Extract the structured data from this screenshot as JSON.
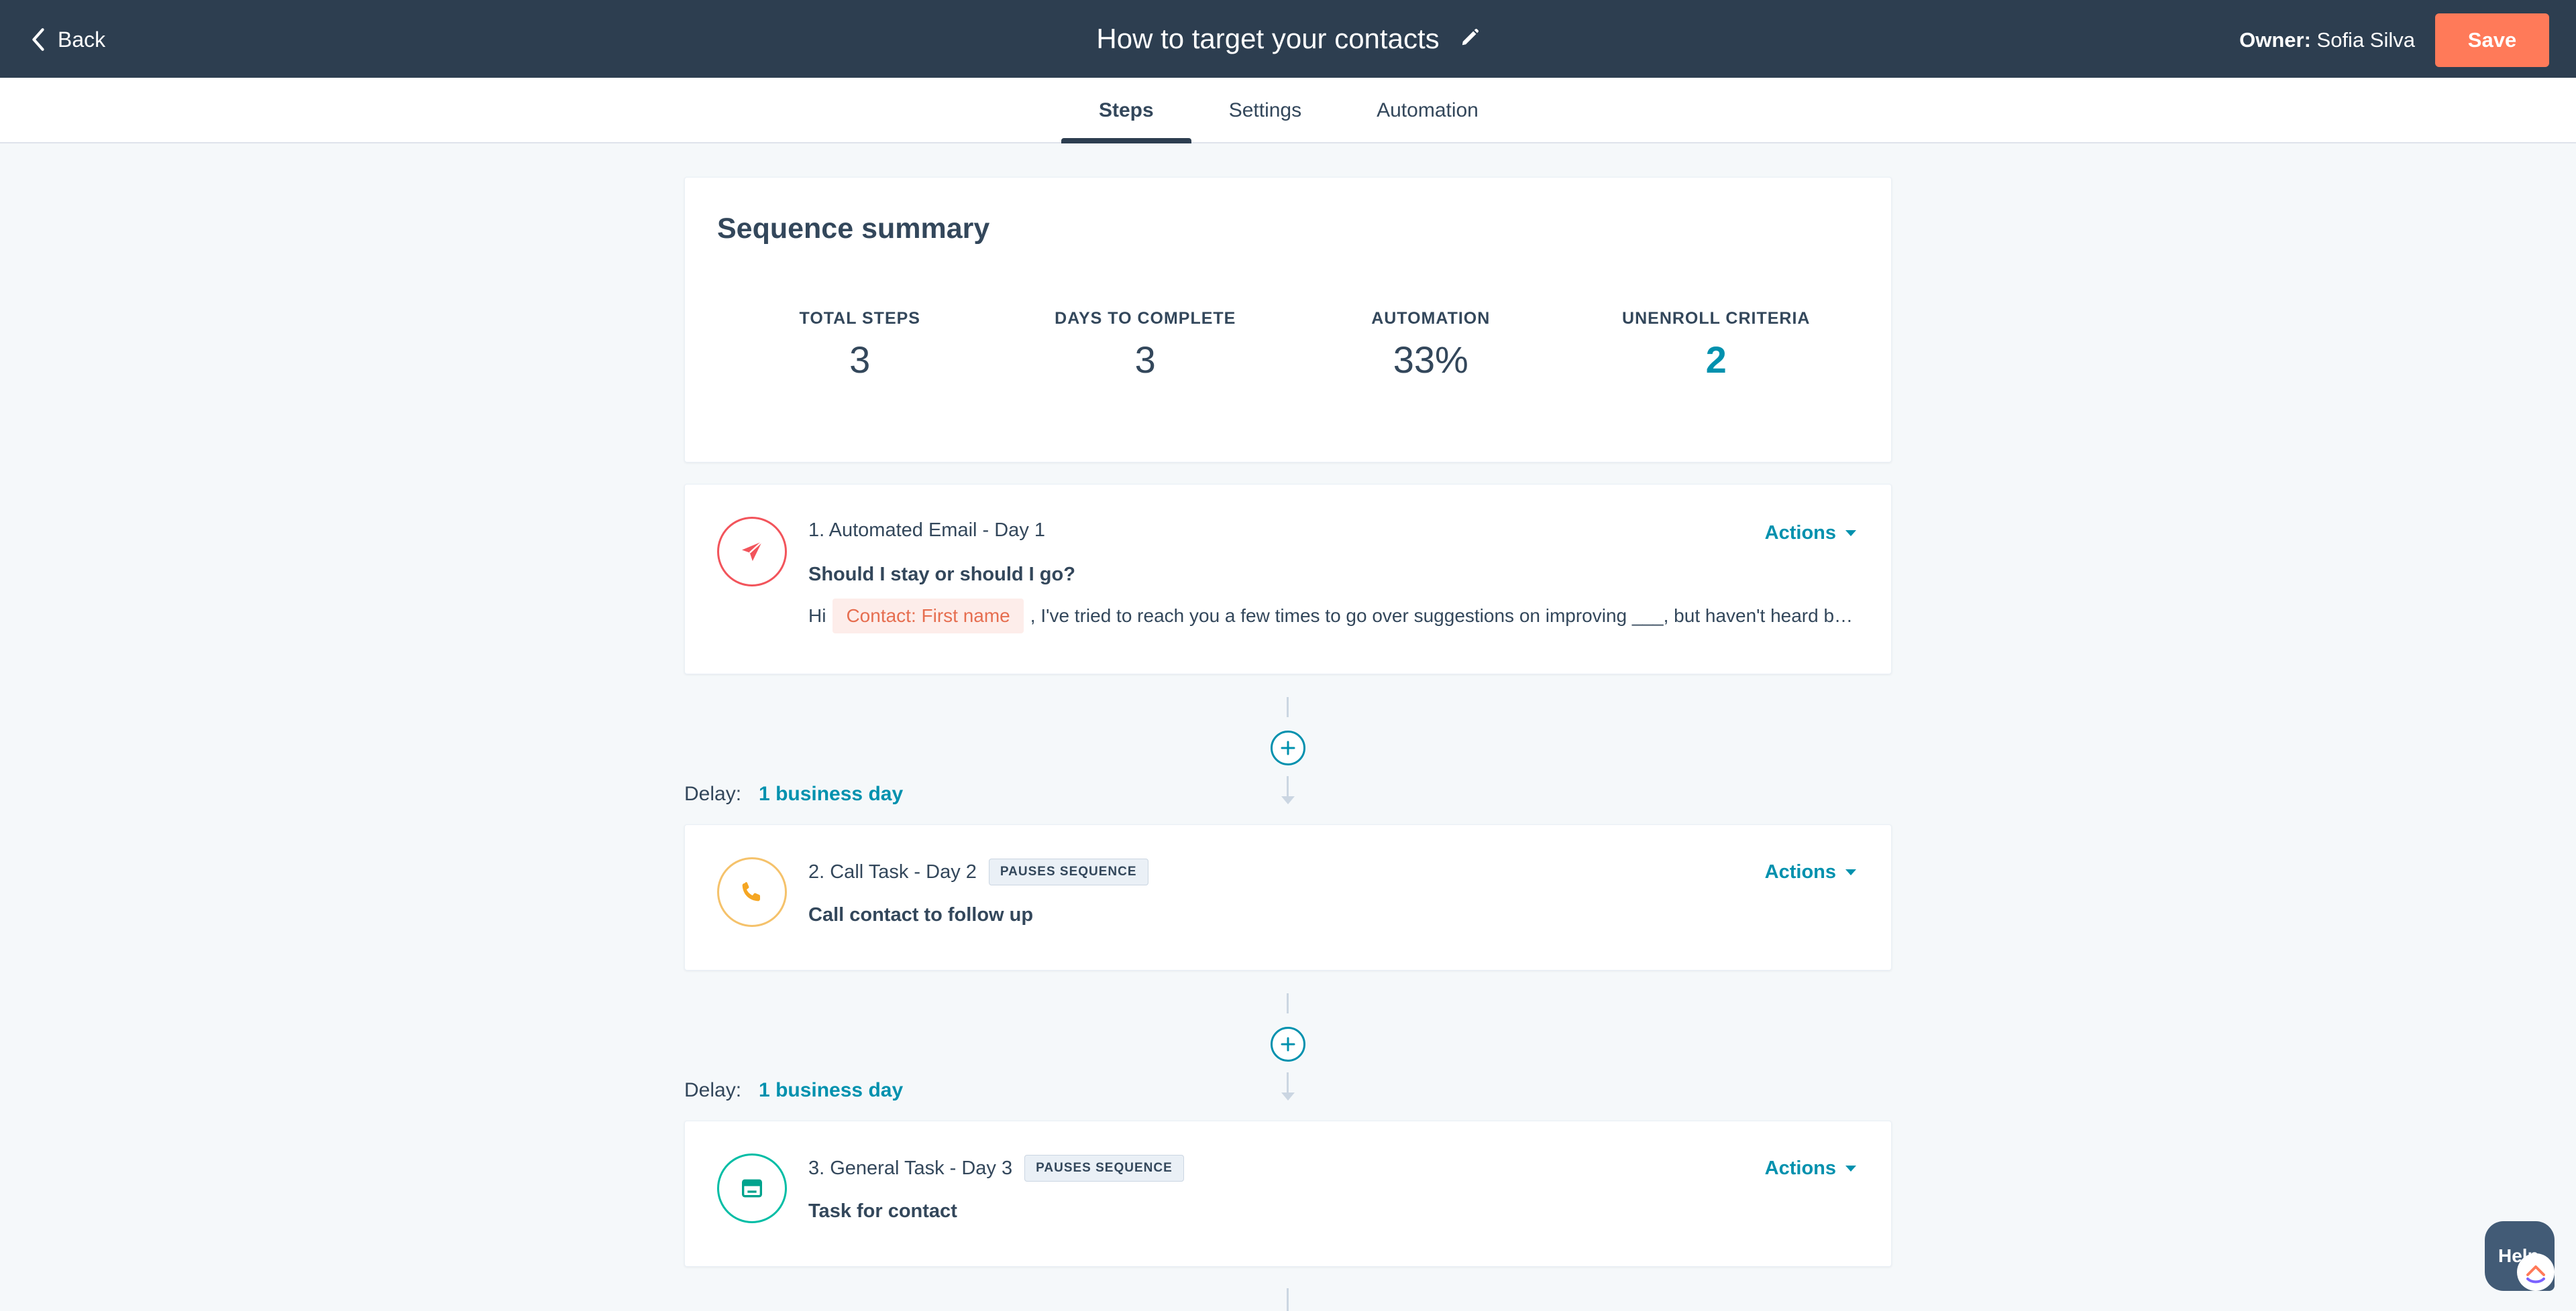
{
  "header": {
    "back_label": "Back",
    "title": "How to target your contacts",
    "owner_label": "Owner:",
    "owner_name": "Sofia Silva",
    "save_label": "Save"
  },
  "tabs": [
    {
      "label": "Steps",
      "active": true
    },
    {
      "label": "Settings",
      "active": false
    },
    {
      "label": "Automation",
      "active": false
    }
  ],
  "summary": {
    "title": "Sequence summary",
    "stats": [
      {
        "label": "TOTAL STEPS",
        "value": "3"
      },
      {
        "label": "DAYS TO COMPLETE",
        "value": "3"
      },
      {
        "label": "AUTOMATION",
        "value": "33%"
      },
      {
        "label": "UNENROLL CRITERIA",
        "value": "2"
      }
    ]
  },
  "steps": [
    {
      "heading": "1. Automated Email - Day 1",
      "subject": "Should I stay or should I go?",
      "preview_start": "Hi",
      "token": "Contact: First name",
      "preview_rest": ", I've tried to reach you a few times to go over suggestions on improving ___, but haven't heard back from you",
      "actions_label": "Actions",
      "icon": "paper-plane-icon",
      "color": "#f2545b"
    },
    {
      "heading": "2. Call Task - Day 2",
      "badge": "PAUSES SEQUENCE",
      "subject": "Call contact to follow up",
      "actions_label": "Actions",
      "icon": "phone-icon",
      "color": "#f5c26b"
    },
    {
      "heading": "3. General Task - Day 3",
      "badge": "PAUSES SEQUENCE",
      "subject": "Task for contact",
      "actions_label": "Actions",
      "icon": "task-icon",
      "color": "#00bda5"
    }
  ],
  "delays": [
    {
      "label": "Delay:",
      "value": "1 business day"
    },
    {
      "label": "Delay:",
      "value": "1 business day"
    }
  ],
  "help": {
    "label": "Help"
  }
}
